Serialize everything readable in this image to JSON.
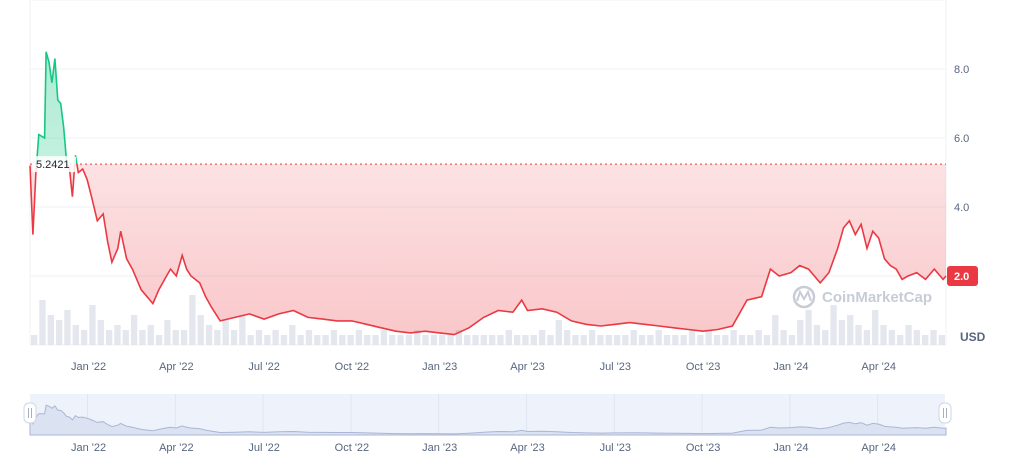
{
  "chart_data": {
    "type": "line",
    "currency_label": "USD",
    "watermark": "CoinMarketCap",
    "reference_value": 5.2421,
    "reference_label": "5.2421",
    "last_value_label": "2.0",
    "colors": {
      "up": "#16c784",
      "down": "#ea3943",
      "grid": "#eff2f5",
      "text": "#58667e",
      "nav_fill": "#eef2fb"
    },
    "ylim": [
      0,
      10
    ],
    "y_ticks": [
      {
        "value": 8.0,
        "label": "8.0"
      },
      {
        "value": 6.0,
        "label": "6.0"
      },
      {
        "value": 4.0,
        "label": "4.0"
      }
    ],
    "x_range": [
      0,
      31.3
    ],
    "x_ticks": [
      {
        "pos": 2.0,
        "label": "Jan '22"
      },
      {
        "pos": 5.0,
        "label": "Apr '22"
      },
      {
        "pos": 8.0,
        "label": "Jul '22"
      },
      {
        "pos": 11.0,
        "label": "Oct '22"
      },
      {
        "pos": 14.0,
        "label": "Jan '23"
      },
      {
        "pos": 17.0,
        "label": "Apr '23"
      },
      {
        "pos": 20.0,
        "label": "Jul '23"
      },
      {
        "pos": 23.0,
        "label": "Oct '23"
      },
      {
        "pos": 26.0,
        "label": "Jan '24"
      },
      {
        "pos": 29.0,
        "label": "Apr '24"
      }
    ],
    "series": [
      {
        "points": [
          [
            0,
            5.2
          ],
          [
            0.1,
            3.2
          ],
          [
            0.2,
            5.0
          ],
          [
            0.3,
            6.1
          ],
          [
            0.5,
            6.0
          ],
          [
            0.55,
            8.5
          ],
          [
            0.65,
            8.2
          ],
          [
            0.75,
            7.6
          ],
          [
            0.85,
            8.3
          ],
          [
            0.95,
            7.1
          ],
          [
            1.05,
            7.0
          ],
          [
            1.15,
            6.3
          ],
          [
            1.25,
            5.3
          ],
          [
            1.35,
            5.1
          ],
          [
            1.45,
            4.3
          ],
          [
            1.55,
            5.5
          ],
          [
            1.65,
            5.0
          ],
          [
            1.8,
            5.1
          ],
          [
            1.95,
            4.8
          ],
          [
            2.1,
            4.3
          ],
          [
            2.3,
            3.6
          ],
          [
            2.5,
            3.8
          ],
          [
            2.65,
            3.0
          ],
          [
            2.8,
            2.4
          ],
          [
            3.0,
            2.8
          ],
          [
            3.1,
            3.3
          ],
          [
            3.3,
            2.5
          ],
          [
            3.5,
            2.2
          ],
          [
            3.8,
            1.6
          ],
          [
            4.0,
            1.4
          ],
          [
            4.2,
            1.2
          ],
          [
            4.4,
            1.6
          ],
          [
            4.6,
            1.9
          ],
          [
            4.8,
            2.2
          ],
          [
            5.0,
            2.0
          ],
          [
            5.2,
            2.6
          ],
          [
            5.35,
            2.2
          ],
          [
            5.5,
            2.0
          ],
          [
            5.8,
            1.8
          ],
          [
            6.0,
            1.4
          ],
          [
            6.2,
            1.1
          ],
          [
            6.5,
            0.7
          ],
          [
            7.0,
            0.8
          ],
          [
            7.5,
            0.9
          ],
          [
            8.0,
            0.75
          ],
          [
            8.5,
            0.9
          ],
          [
            9.0,
            1.0
          ],
          [
            9.5,
            0.8
          ],
          [
            10.0,
            0.75
          ],
          [
            10.5,
            0.7
          ],
          [
            11.0,
            0.7
          ],
          [
            11.5,
            0.6
          ],
          [
            12.0,
            0.5
          ],
          [
            12.5,
            0.4
          ],
          [
            13.0,
            0.35
          ],
          [
            13.5,
            0.4
          ],
          [
            14.0,
            0.35
          ],
          [
            14.5,
            0.3
          ],
          [
            15.0,
            0.5
          ],
          [
            15.5,
            0.8
          ],
          [
            16.0,
            1.0
          ],
          [
            16.5,
            0.95
          ],
          [
            16.8,
            1.3
          ],
          [
            17.0,
            1.0
          ],
          [
            17.5,
            1.05
          ],
          [
            18.0,
            0.95
          ],
          [
            18.5,
            0.7
          ],
          [
            19.0,
            0.6
          ],
          [
            19.5,
            0.55
          ],
          [
            20.0,
            0.6
          ],
          [
            20.5,
            0.65
          ],
          [
            21.0,
            0.6
          ],
          [
            21.5,
            0.55
          ],
          [
            22.0,
            0.5
          ],
          [
            22.5,
            0.45
          ],
          [
            23.0,
            0.4
          ],
          [
            23.5,
            0.45
          ],
          [
            24.0,
            0.55
          ],
          [
            24.5,
            1.3
          ],
          [
            25.0,
            1.4
          ],
          [
            25.3,
            2.2
          ],
          [
            25.6,
            2.0
          ],
          [
            26.0,
            2.1
          ],
          [
            26.3,
            2.3
          ],
          [
            26.6,
            2.2
          ],
          [
            27.0,
            1.8
          ],
          [
            27.3,
            2.1
          ],
          [
            27.6,
            2.8
          ],
          [
            27.8,
            3.4
          ],
          [
            28.0,
            3.6
          ],
          [
            28.2,
            3.2
          ],
          [
            28.4,
            3.5
          ],
          [
            28.6,
            2.8
          ],
          [
            28.8,
            3.3
          ],
          [
            29.0,
            3.1
          ],
          [
            29.2,
            2.5
          ],
          [
            29.4,
            2.3
          ],
          [
            29.6,
            2.2
          ],
          [
            29.8,
            1.9
          ],
          [
            30.0,
            2.0
          ],
          [
            30.3,
            2.1
          ],
          [
            30.6,
            1.9
          ],
          [
            30.9,
            2.2
          ],
          [
            31.2,
            1.9
          ],
          [
            31.3,
            2.0
          ]
        ]
      }
    ],
    "volume": [
      0.2,
      0.9,
      0.6,
      0.5,
      0.7,
      0.4,
      0.3,
      0.8,
      0.5,
      0.3,
      0.4,
      0.3,
      0.6,
      0.3,
      0.4,
      0.2,
      0.5,
      0.3,
      0.3,
      1.0,
      0.6,
      0.4,
      0.3,
      0.5,
      0.3,
      0.6,
      0.2,
      0.3,
      0.2,
      0.3,
      0.2,
      0.4,
      0.2,
      0.3,
      0.2,
      0.2,
      0.3,
      0.2,
      0.2,
      0.3,
      0.2,
      0.2,
      0.3,
      0.2,
      0.2,
      0.2,
      0.3,
      0.2,
      0.2,
      0.2,
      0.2,
      0.3,
      0.2,
      0.2,
      0.2,
      0.2,
      0.2,
      0.3,
      0.2,
      0.2,
      0.2,
      0.3,
      0.2,
      0.5,
      0.3,
      0.2,
      0.2,
      0.3,
      0.2,
      0.2,
      0.2,
      0.2,
      0.3,
      0.2,
      0.2,
      0.3,
      0.2,
      0.2,
      0.2,
      0.3,
      0.2,
      0.3,
      0.2,
      0.2,
      0.3,
      0.2,
      0.2,
      0.3,
      0.2,
      0.6,
      0.3,
      0.2,
      0.5,
      0.7,
      0.4,
      0.3,
      0.8,
      0.5,
      0.6,
      0.4,
      0.3,
      0.7,
      0.4,
      0.3,
      0.2,
      0.4,
      0.3,
      0.2,
      0.3,
      0.2
    ]
  }
}
